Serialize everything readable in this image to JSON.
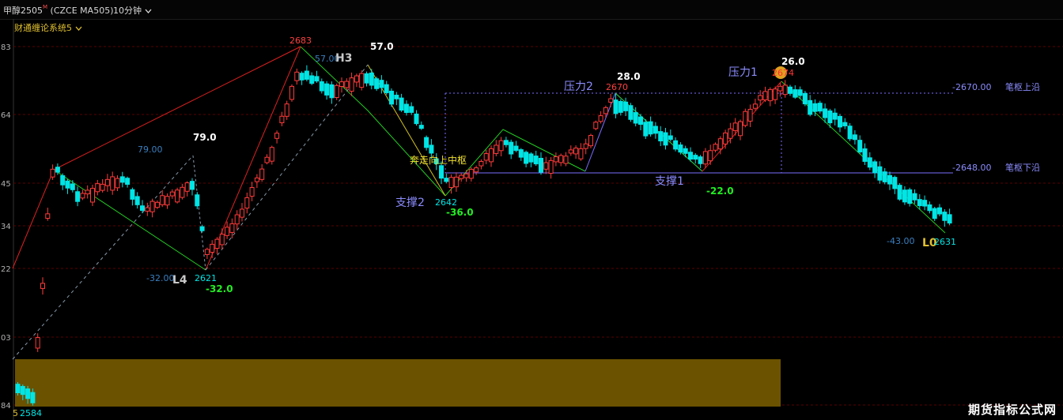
{
  "header": {
    "title": "甲醇2505",
    "title_sup": "M",
    "contract": "(CZCE MA505)",
    "period": "10分钟",
    "period_arrow": "chevron-down-icon"
  },
  "indicator": {
    "name": "财通缠论系统5",
    "arrow": "chevron-down-icon"
  },
  "y_axis": {
    "tick_labels": [
      "83",
      "64",
      "45",
      "34",
      "22",
      "03",
      "84"
    ]
  },
  "annotations": {
    "top_left_label": "2683",
    "h3_label": "H3",
    "h3_value": "57.0",
    "h3_small": "57.00",
    "peak_2683_amp": "57.0",
    "l4_label": "L4",
    "l4_price": "2621",
    "l4_amp": "-32.0",
    "l4_small": "-32.00",
    "up_79": "79.0",
    "up_79_small": "79.00",
    "mid_pivot_text": "奔走向上中枢",
    "support2": "支撑2",
    "support2_price": "2642",
    "support2_amp": "-36.0",
    "press2": "压力2",
    "press2_price": "2670",
    "press2_amp": "28.0",
    "support1": "支撑1",
    "support1_amp": "-22.0",
    "press1": "压力1",
    "press1_price": "2674",
    "press1_amp": "26.0",
    "l0_label": "L0",
    "l0_price": "2631",
    "l0_small": "-43.00",
    "level_upper": "-2670.00",
    "level_upper_name": "笔枢上沿",
    "level_lower": "-2648.00",
    "level_lower_name": "笔枢下沿",
    "bottom_left_price": "2584",
    "bottom_left_small": "5"
  },
  "colors": {
    "up_candle": "#ff3b3b",
    "down_candle": "#00e5e5",
    "green_line": "#22cc22",
    "red_line": "#e02020",
    "purple_line": "#7a6cff",
    "gold_box": "#6b5200",
    "grid": "#5a0000"
  },
  "watermark": "期货指标公式网"
}
